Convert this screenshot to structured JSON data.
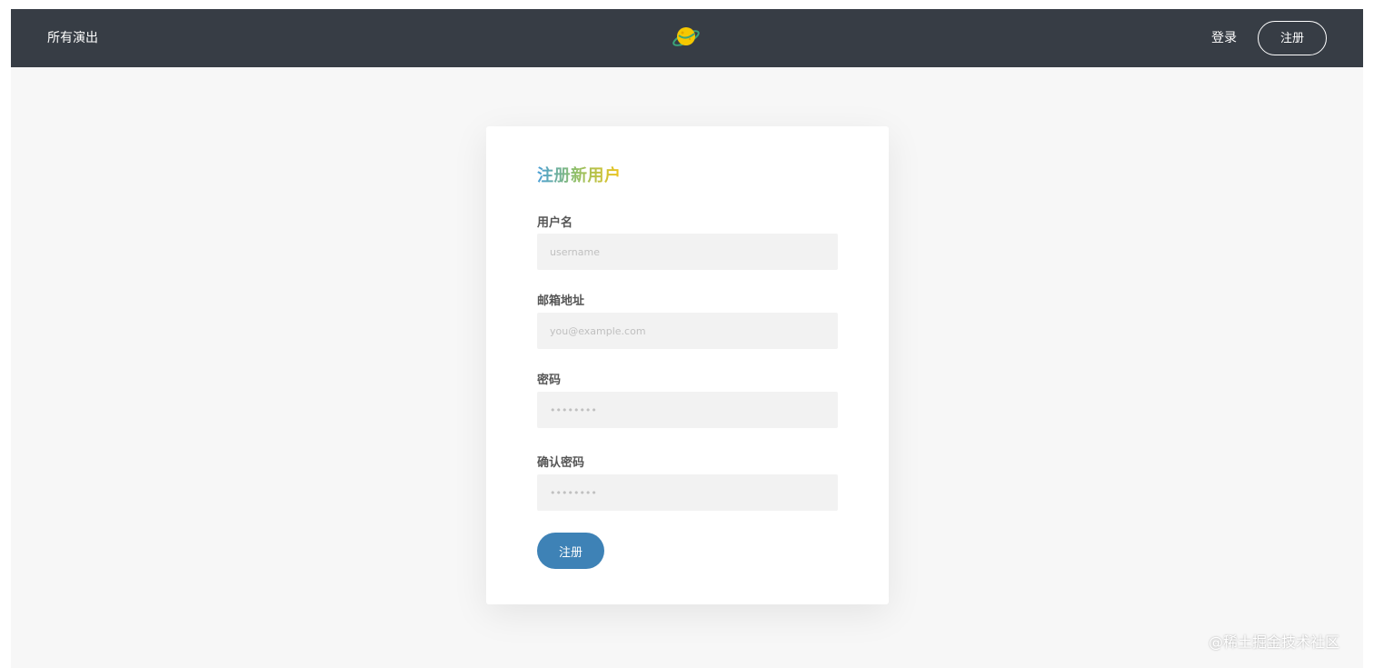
{
  "navbar": {
    "left_link": "所有演出",
    "logo_icon": "planet-icon",
    "login_label": "登录",
    "register_label": "注册"
  },
  "form": {
    "title": "注册新用户",
    "fields": [
      {
        "label": "用户名",
        "placeholder": "username",
        "type": "text"
      },
      {
        "label": "邮箱地址",
        "placeholder": "you@example.com",
        "type": "email"
      },
      {
        "label": "密码",
        "placeholder": "••••••••",
        "type": "password"
      },
      {
        "label": "确认密码",
        "placeholder": "••••••••",
        "type": "password"
      }
    ],
    "submit_label": "注册"
  },
  "watermark": "@稀土掘金技术社区",
  "colors": {
    "navbar_bg": "#373d45",
    "page_bg": "#f7f7f7",
    "primary_button": "#3e82b6",
    "input_bg": "#f2f2f2"
  }
}
